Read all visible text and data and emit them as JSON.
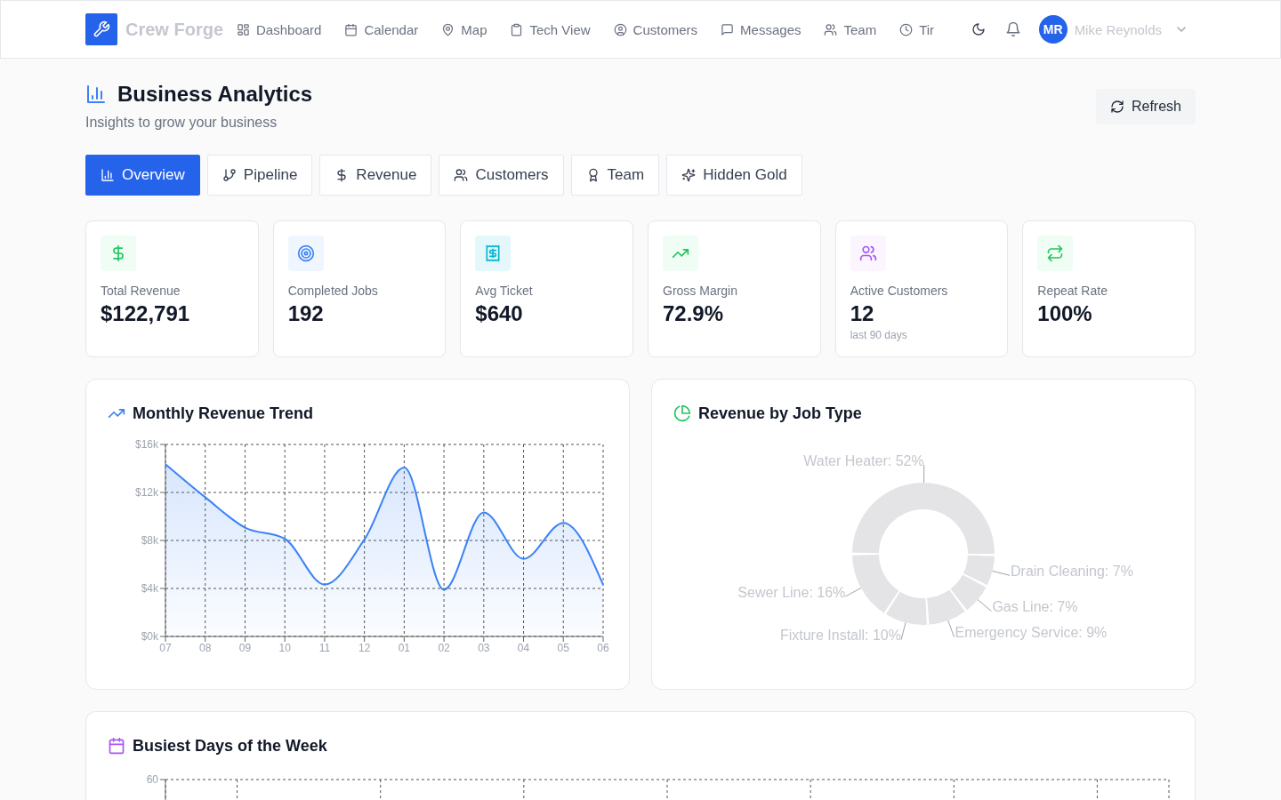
{
  "header": {
    "brand": "Crew Forge",
    "nav": [
      {
        "label": "Dashboard"
      },
      {
        "label": "Calendar"
      },
      {
        "label": "Map"
      },
      {
        "label": "Tech View"
      },
      {
        "label": "Customers"
      },
      {
        "label": "Messages"
      },
      {
        "label": "Team"
      },
      {
        "label": "Tir"
      }
    ],
    "user": {
      "initials": "MR",
      "name": "Mike Reynolds"
    }
  },
  "page": {
    "title": "Business Analytics",
    "subtitle": "Insights to grow your business",
    "refresh_button": "Refresh"
  },
  "tabs": [
    {
      "label": "Overview",
      "selected": true
    },
    {
      "label": "Pipeline",
      "selected": false
    },
    {
      "label": "Revenue",
      "selected": false
    },
    {
      "label": "Customers",
      "selected": false
    },
    {
      "label": "Team",
      "selected": false
    },
    {
      "label": "Hidden Gold",
      "selected": false
    }
  ],
  "stats": [
    {
      "label": "Total Revenue",
      "value": "$122,791"
    },
    {
      "label": "Completed Jobs",
      "value": "192"
    },
    {
      "label": "Avg Ticket",
      "value": "$640"
    },
    {
      "label": "Gross Margin",
      "value": "72.9%"
    },
    {
      "label": "Active Customers",
      "value": "12",
      "note": "last 90 days"
    },
    {
      "label": "Repeat Rate",
      "value": "100%"
    }
  ],
  "revenue_trend": {
    "chart_data": {
      "type": "area",
      "title": "Monthly Revenue Trend",
      "categories": [
        "07",
        "08",
        "09",
        "10",
        "11",
        "12",
        "01",
        "02",
        "03",
        "04",
        "05",
        "06"
      ],
      "series": [
        {
          "color": "#3b82f6",
          "values": [
            14360,
            11600,
            9070,
            8140,
            4330,
            8080,
            14070,
            3900,
            10340,
            6470,
            9470,
            4300
          ]
        }
      ],
      "ylim": [
        0,
        16000
      ],
      "yticks": [
        {
          "value": 0,
          "label": "$0k"
        },
        {
          "value": 4000,
          "label": "$4k"
        },
        {
          "value": 8000,
          "label": "$8k"
        },
        {
          "value": 12000,
          "label": "$12k"
        },
        {
          "value": 16000,
          "label": "$16k"
        }
      ],
      "grid": true
    }
  },
  "revenue_by_job_type": {
    "chart_data": {
      "type": "donut",
      "title": "Revenue by Job Type",
      "values": [
        52,
        16,
        10,
        9,
        7,
        7
      ],
      "value_labels": [
        "Water Heater: 52%",
        "Sewer Line: 16%",
        "Fixture Install: 10%",
        "Emergency Service: 9%",
        "Gas Line: 7%",
        "Drain Cleaning: 7%"
      ]
    }
  },
  "busiest_days": {
    "title": "Busiest Days of the Week",
    "y_tick": "60"
  }
}
